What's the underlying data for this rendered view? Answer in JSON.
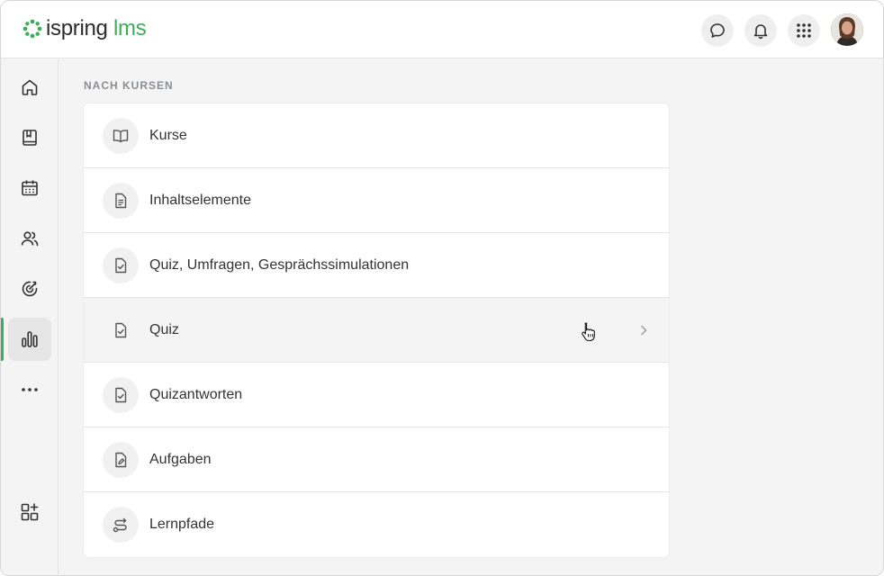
{
  "app": {
    "logo_part1": "ispring",
    "logo_part2": "lms",
    "brand_color": "#3fae5a"
  },
  "header": {
    "buttons": [
      {
        "name": "chat-icon"
      },
      {
        "name": "bell-icon"
      },
      {
        "name": "apps-grid-icon"
      }
    ],
    "avatar": "user-avatar"
  },
  "sidebar": {
    "items": [
      {
        "icon": "home-icon"
      },
      {
        "icon": "book-icon"
      },
      {
        "icon": "calendar-icon"
      },
      {
        "icon": "users-icon"
      },
      {
        "icon": "target-icon"
      },
      {
        "icon": "reports-chart-icon",
        "active": true
      },
      {
        "icon": "more-icon"
      },
      {
        "icon": "add-widget-icon"
      }
    ]
  },
  "main": {
    "section_title": "NACH KURSEN",
    "rows": [
      {
        "label": "Kurse",
        "icon": "book-open-icon"
      },
      {
        "label": "Inhaltselemente",
        "icon": "document-icon"
      },
      {
        "label": "Quiz, Umfragen, Gesprächssimulationen",
        "icon": "check-document-icon"
      },
      {
        "label": "Quiz",
        "icon": "check-document-icon",
        "hovered": true
      },
      {
        "label": "Quizantworten",
        "icon": "check-document-icon"
      },
      {
        "label": "Aufgaben",
        "icon": "edit-document-icon"
      },
      {
        "label": "Lernpfade",
        "icon": "route-icon"
      }
    ]
  }
}
